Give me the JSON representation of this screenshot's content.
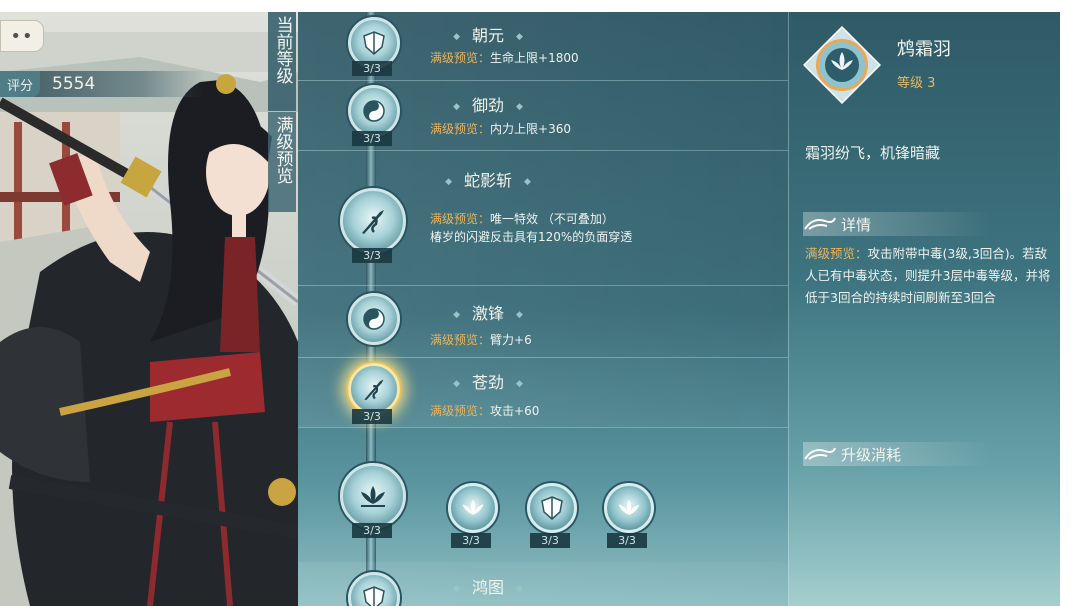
{
  "score": {
    "label": "评分",
    "value": "5554"
  },
  "menu_button": {
    "label": "••"
  },
  "side_tabs": [
    {
      "label": "当前等级"
    },
    {
      "label": "满级预览"
    }
  ],
  "talents": [
    {
      "title": "朝元",
      "preview_label": "满级预览：",
      "effect": "生命上限+1800",
      "count": "3/3",
      "icon": "shield-icon"
    },
    {
      "title": "御劲",
      "preview_label": "满级预览：",
      "effect": "内力上限+360",
      "count": "3/3",
      "icon": "yin-yang-icon"
    },
    {
      "title": "蛇影斩",
      "preview_label": "满级预览：",
      "effect": "唯一特效 （不可叠加）",
      "extra": "椿岁的闪避反击具有120%的负面穿透",
      "count": "3/3",
      "icon": "serpent-blade-icon"
    },
    {
      "title": "激锋",
      "preview_label": "满级预览：",
      "effect": "臂力+6",
      "count": "3/3",
      "icon": "yin-yang-icon"
    },
    {
      "title": "苍劲",
      "preview_label": "满级预览：",
      "effect": "攻击+60",
      "count": "3/3",
      "icon": "serpent-blade-icon"
    },
    {
      "title": "鸿图",
      "preview_label": "",
      "effect": "",
      "count": "",
      "icon": "shield-icon"
    }
  ],
  "branch_node": {
    "count": "3/3",
    "icon": "lotus-icon"
  },
  "branch_options": [
    {
      "count": "3/3",
      "icon": "lotus-icon"
    },
    {
      "count": "3/3",
      "icon": "shield-icon"
    },
    {
      "count": "3/3",
      "icon": "lotus-icon"
    }
  ],
  "detail": {
    "name": "鸩霜羽",
    "level": "等级 3",
    "motto": "霜羽纷飞，机锋暗藏",
    "section_details": "详情",
    "preview_label": "满级预览：",
    "description": "攻击附带中毒(3级,3回合)。若敌人已有中毒状态，则提升3层中毒等级，并将低于3回合的持续时间刷新至3回合",
    "section_cost": "升级消耗",
    "icon": "lotus-icon"
  },
  "colors": {
    "gold": "#e9b45d",
    "panel": "#3b6f7c",
    "glow": "#e3c15b"
  }
}
